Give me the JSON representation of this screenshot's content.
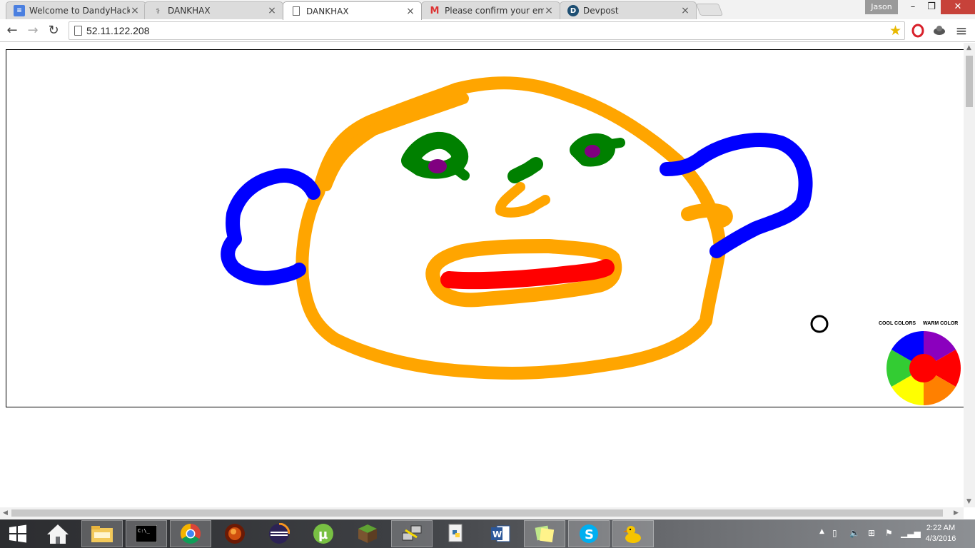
{
  "tabs": [
    {
      "title": "Welcome to DandyHacks!",
      "icon": "docs-icon",
      "active": false
    },
    {
      "title": "DANKHAX",
      "icon": "caduceus-icon",
      "active": false
    },
    {
      "title": "DANKHAX",
      "icon": "page-icon",
      "active": true
    },
    {
      "title": "Please confirm your email",
      "icon": "gmail-icon",
      "active": false
    },
    {
      "title": "Devpost",
      "icon": "devpost-icon",
      "active": false
    }
  ],
  "profile": "Jason",
  "window": {
    "minimize": "–",
    "restore": "❐",
    "close": "✕"
  },
  "toolbar": {
    "url": "52.11.122.208",
    "back": "←",
    "forward": "→",
    "reload": "↻",
    "menu": "≡"
  },
  "colors": {
    "stroke_orange": "#FFA500",
    "stroke_blue": "#0000FF",
    "stroke_green": "#008000",
    "stroke_purple": "#800080",
    "stroke_red": "#FF0000"
  },
  "page": {
    "wheel": {
      "cool_label": "COOL COLORS",
      "warm_label": "WARM COLOR",
      "segments": [
        "#8B00BE",
        "#FF0000",
        "#FF8000",
        "#FFFF00",
        "#33CC33",
        "#0000FF"
      ],
      "center": "#FF0000"
    }
  },
  "taskbar": {
    "apps": [
      "start-icon",
      "home-icon",
      "file-explorer-icon",
      "command-prompt-icon",
      "chrome-icon",
      "dragon-app-icon",
      "eclipse-icon",
      "utorrent-icon",
      "minecraft-icon",
      "network-app-icon",
      "python-icon",
      "word-icon",
      "sticky-notes-icon",
      "skype-icon",
      "duck-app-icon"
    ],
    "clock_time": "2:22 AM",
    "clock_date": "4/3/2016"
  }
}
